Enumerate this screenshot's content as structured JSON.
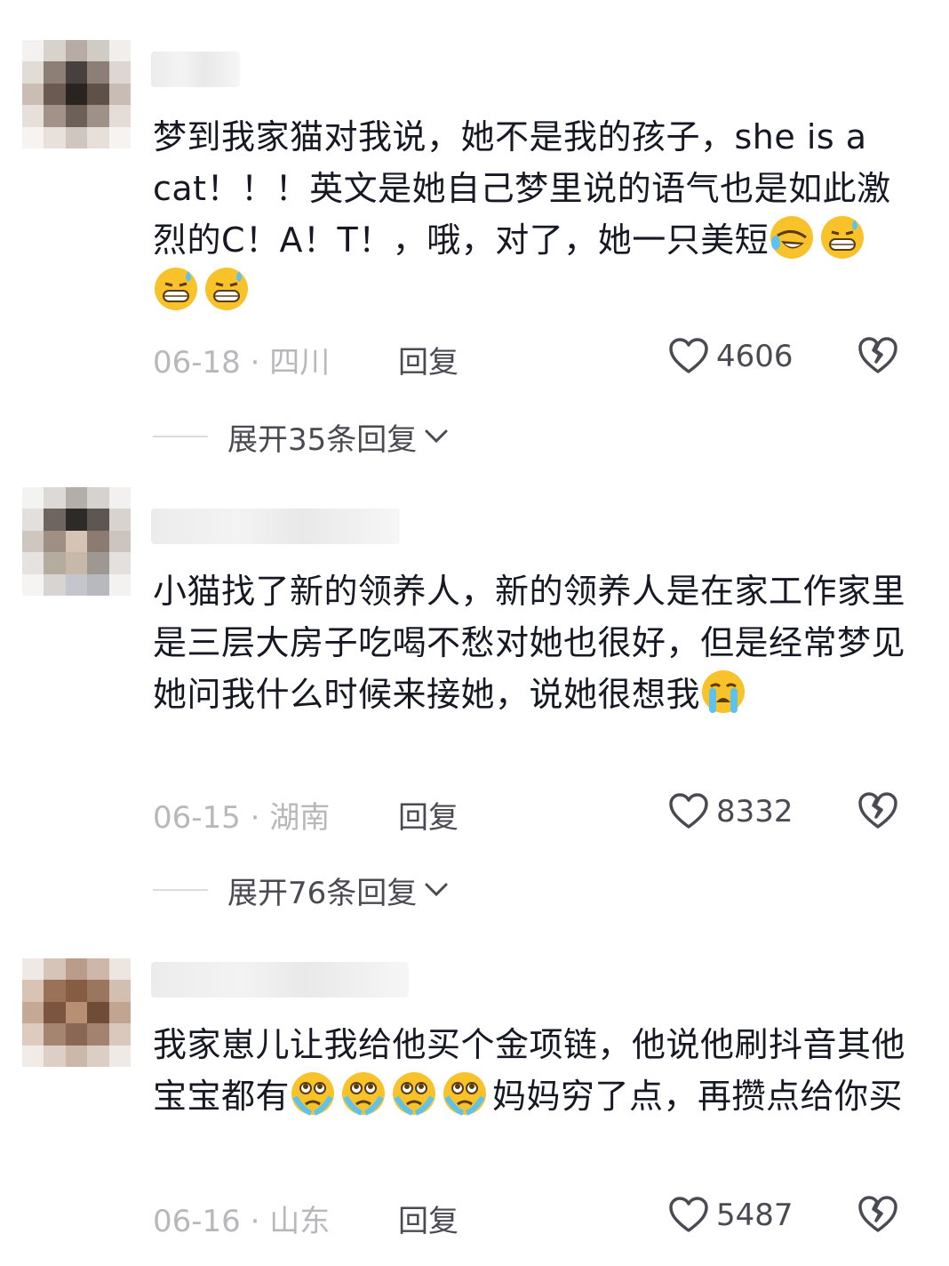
{
  "comments": [
    {
      "text": "梦到我家猫对我说，她不是我的孩子，she is a cat！！！英文是她自己梦里说的语气也是如此激烈的C！A！T！，哦，对了，她一只美短",
      "emojis": [
        "laugh-cry-emoji",
        "sweat-grin-emoji",
        "sweat-grin-emoji",
        "sweat-grin-emoji"
      ],
      "date": "06-18",
      "location": "四川",
      "reply_label": "回复",
      "likes": "4606",
      "expand_label": "展开35条回复"
    },
    {
      "text": "小猫找了新的领养人，新的领养人是在家工作家里是三层大房子吃喝不愁对她也很好，但是经常梦见她问我什么时候来接她，说她很想我",
      "emojis": [
        "crying-emoji"
      ],
      "date": "06-15",
      "location": "湖南",
      "reply_label": "回复",
      "likes": "8332",
      "expand_label": "展开76条回复"
    },
    {
      "text_before": "我家崽儿让我给他买个金项链，他说他刷抖音其他宝宝都有",
      "text_after": "妈妈穷了点，再攒点给你买",
      "emojis": [
        "tearful-emoji",
        "tearful-emoji",
        "tearful-emoji",
        "tearful-emoji"
      ],
      "date": "06-16",
      "location": "山东",
      "reply_label": "回复",
      "likes": "5487"
    }
  ],
  "meta_separator": "·",
  "icons": [
    "heart-outline-icon",
    "broken-heart-icon",
    "chevron-down-icon"
  ],
  "colors": {
    "text": "#161823",
    "muted": "#b8b8bc",
    "secondary": "#4a4a52"
  }
}
